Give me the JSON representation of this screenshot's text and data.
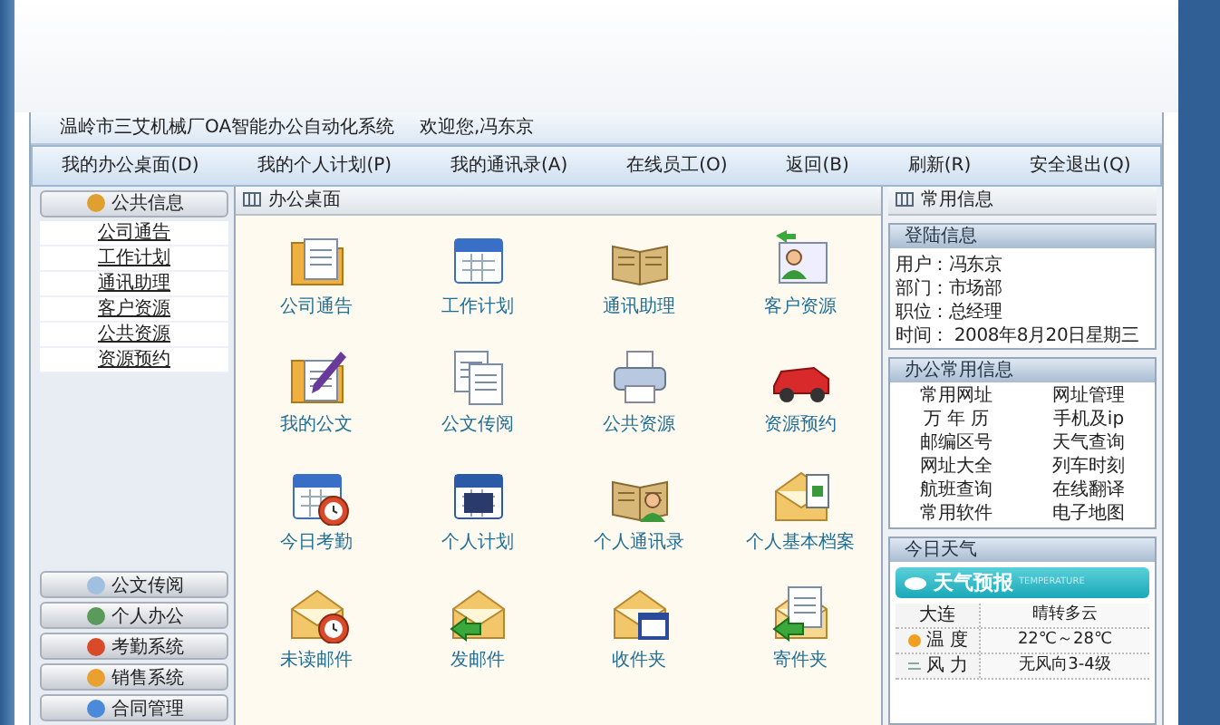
{
  "title_bar": {
    "system": "温岭市三艾机械厂OA智能办公自动化系统",
    "welcome": "欢迎您,冯东京"
  },
  "menu": [
    "我的办公桌面(D)",
    "我的个人计划(P)",
    "我的通讯录(A)",
    "在线员工(O)",
    "返回(B)",
    "刷新(R)",
    "安全退出(Q)"
  ],
  "sidebar": {
    "groups": [
      {
        "label": "公共信息",
        "expanded": true,
        "children": [
          "公司通告",
          "工作计划",
          "通讯助理",
          "客户资源",
          "公共资源",
          "资源预约"
        ]
      },
      {
        "label": "公文传阅",
        "expanded": false
      },
      {
        "label": "个人办公",
        "expanded": false
      },
      {
        "label": "考勤系统",
        "expanded": false
      },
      {
        "label": "销售系统",
        "expanded": false
      },
      {
        "label": "合同管理",
        "expanded": false
      }
    ]
  },
  "desktop": {
    "title": "办公桌面",
    "items": [
      "公司通告",
      "工作计划",
      "通讯助理",
      "客户资源",
      "我的公文",
      "公文传阅",
      "公共资源",
      "资源预约",
      "今日考勤",
      "个人计划",
      "个人通讯录",
      "个人基本档案",
      "未读邮件",
      "发邮件",
      "收件夹",
      "寄件夹"
    ]
  },
  "info_panel": {
    "title": "常用信息",
    "login": {
      "title": "登陆信息",
      "lines": [
        "用户：冯东京",
        "部门：市场部",
        "职位：总经理",
        "时间： 2008年8月20日星期三"
      ]
    },
    "links": {
      "title": "办公常用信息",
      "items": [
        "常用网址",
        "网址管理",
        "万 年 历",
        "手机及ip",
        "邮编区号",
        "天气查询",
        "网址大全",
        "列车时刻",
        "航班查询",
        "在线翻译",
        "常用软件",
        "电子地图"
      ]
    },
    "weather": {
      "title": "今日天气",
      "banner": "天气预报",
      "banner_sub": "TEMPERATURE",
      "rows": [
        {
          "kind": "city",
          "label": "大连",
          "value": "晴转多云"
        },
        {
          "kind": "temperature",
          "label": "温 度",
          "value": "22℃～28℃"
        },
        {
          "kind": "wind",
          "label": "风 力",
          "value": "无风向3-4级"
        }
      ]
    }
  }
}
